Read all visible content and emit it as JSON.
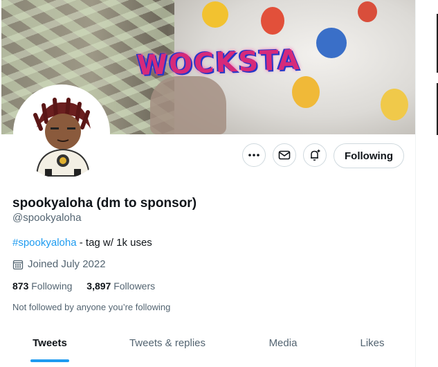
{
  "banner": {
    "title": "WOCKSTA"
  },
  "actions": {
    "more_icon": "more-dots-icon",
    "message_icon": "envelope-icon",
    "notify_icon": "bell-plus-icon",
    "follow_label": "Following"
  },
  "profile": {
    "display_name": "spookyaloha (dm to sponsor)",
    "handle": "@spookyaloha",
    "bio_hashtag": "#spookyaloha",
    "bio_text": " - tag w/ 1k uses",
    "joined": "Joined July 2022",
    "following_count": "873",
    "following_label": "Following",
    "followers_count": "3,897",
    "followers_label": "Followers",
    "not_followed": "Not followed by anyone you’re following"
  },
  "tabs": [
    {
      "label": "Tweets",
      "active": true
    },
    {
      "label": "Tweets & replies",
      "active": false
    },
    {
      "label": "Media",
      "active": false
    },
    {
      "label": "Likes",
      "active": false
    }
  ],
  "colors": {
    "accent": "#1d9bf0",
    "text": "#0f1419",
    "muted": "#536471",
    "border": "#cfd9de"
  }
}
